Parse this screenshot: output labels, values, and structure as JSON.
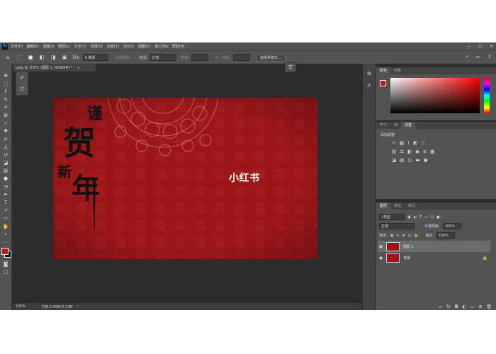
{
  "app": {
    "logo": "Ps",
    "menu": [
      "文件(F)",
      "编辑(E)",
      "图像(I)",
      "图层(L)",
      "文字(Y)",
      "选择(S)",
      "滤镜(T)",
      "3D(D)",
      "视图(V)",
      "窗口(W)",
      "帮助(H)"
    ],
    "window_controls": [
      "—",
      "□",
      "✕"
    ]
  },
  "options_bar": {
    "feather_label": "羽化:",
    "feather_value": "0 像素",
    "antialias_label": "消除锯齿",
    "style_label": "样式:",
    "style_value": "正常",
    "width_label": "宽度:",
    "height_label": "高度:",
    "select_button": "选择并遮住..."
  },
  "document": {
    "tab_title": "ipeg @ 100% (图层 1, RGB/8#) *",
    "close": "×",
    "brand_text": "小红书",
    "calligraphy": [
      "谨",
      "贺",
      "新",
      "年"
    ],
    "pattern_glyphs": [
      "福",
      "寿"
    ],
    "zoom": "100%",
    "doc_size": "文档:2.09M/4.13M"
  },
  "color_panel": {
    "tabs": [
      "颜色",
      "色板"
    ]
  },
  "adjustments_panel": {
    "tabs": [
      "学习",
      "库",
      "调整"
    ],
    "title": "添加调整"
  },
  "layers_panel": {
    "tabs": [
      "图层",
      "通道",
      "路径"
    ],
    "kind_filter": "类型",
    "blend_mode": "正常",
    "opacity_label": "不透明度:",
    "opacity_value": "100%",
    "lock_label": "锁定:",
    "fill_label": "填充:",
    "fill_value": "100%",
    "layers": [
      {
        "name": "图层 1",
        "selected": true,
        "locked": false
      },
      {
        "name": "背景",
        "selected": false,
        "locked": true
      }
    ]
  },
  "colors": {
    "foreground": "#c0141a",
    "background": "#000000",
    "canvas_red": "#9c1619"
  }
}
